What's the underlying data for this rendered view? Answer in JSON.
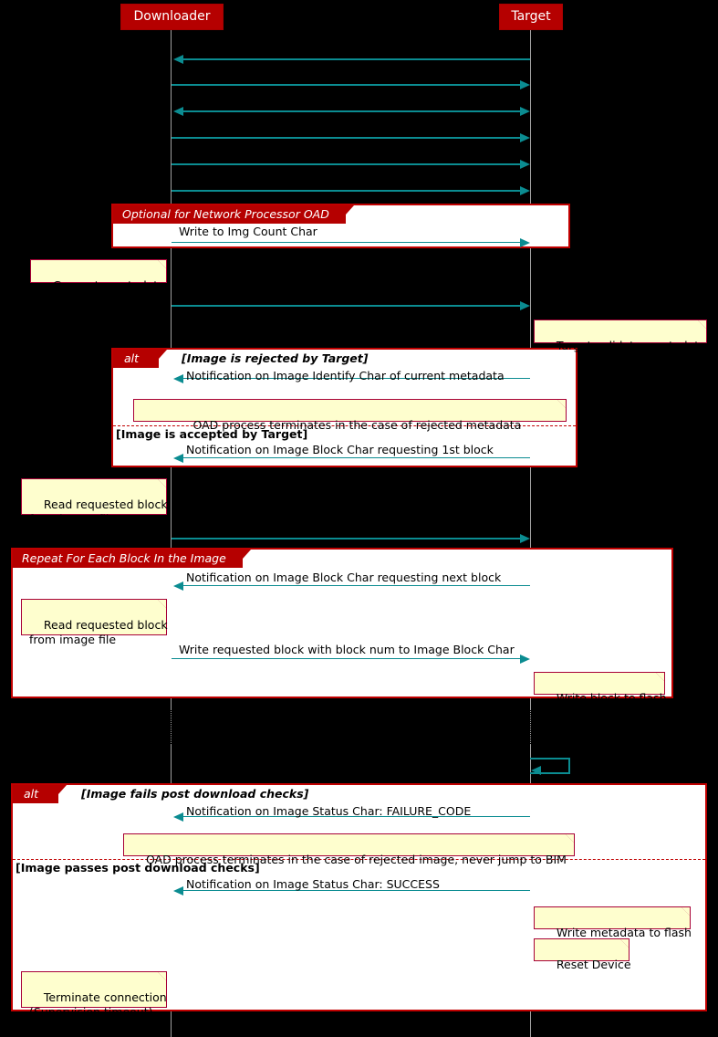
{
  "diagram": {
    "kind": "sequence-diagram",
    "title": "",
    "colors": {
      "background": "#000000",
      "participant_fill": "#B50000",
      "participant_text": "#FFFFFF",
      "arrow": "#0B8C91",
      "lifeline": "#A0A0A0",
      "group_border": "#C00000",
      "group_tab_fill": "#B50000",
      "note_fill": "#FEFECE",
      "note_border": "#A80036",
      "text": "#000000"
    }
  },
  "participants": [
    {
      "id": "downloader",
      "label": "Downloader"
    },
    {
      "id": "target",
      "label": "Target"
    }
  ],
  "messages": [
    {
      "id": "m1",
      "label": "",
      "direction": "left"
    },
    {
      "id": "m2",
      "label": "",
      "direction": "right"
    },
    {
      "id": "m3",
      "label": "",
      "direction": "both"
    },
    {
      "id": "m4",
      "label": "",
      "direction": "right"
    },
    {
      "id": "m5",
      "label": "",
      "direction": "right"
    },
    {
      "id": "m6",
      "label": "",
      "direction": "right"
    },
    {
      "id": "m7",
      "label": "Write to Img Count Char",
      "direction": "right"
    },
    {
      "id": "m8",
      "label": "",
      "direction": "right"
    },
    {
      "id": "m9",
      "label": "Notification on Image Identify Char of current metadata",
      "direction": "left"
    },
    {
      "id": "m10",
      "label": "Notification on Image Block Char requesting 1st block",
      "direction": "left"
    },
    {
      "id": "m11",
      "label": "",
      "direction": "right"
    },
    {
      "id": "m12",
      "label": "Notification on Image Block Char requesting next block",
      "direction": "left"
    },
    {
      "id": "m13",
      "label": "Write requested block with block num to Image Block Char",
      "direction": "right"
    },
    {
      "id": "m14",
      "label": "",
      "direction": "self"
    },
    {
      "id": "m15",
      "label": "Notification on Image Status Char: FAILURE_CODE",
      "direction": "left"
    },
    {
      "id": "m16",
      "label": "Notification on Image Status Char: SUCCESS",
      "direction": "left"
    }
  ],
  "groups": [
    {
      "id": "g-optional",
      "tab": "Optional for Network Processor OAD",
      "conditions": []
    },
    {
      "id": "g-alt-metadata",
      "tab": "alt",
      "conditions": [
        "[Image is rejected by Target]",
        "[Image is accepted by Target]"
      ]
    },
    {
      "id": "g-repeat",
      "tab": "Repeat For Each Block In the Image",
      "conditions": []
    },
    {
      "id": "g-alt-postcheck",
      "tab": "alt",
      "conditions": [
        "[Image fails post download checks]",
        "[Image passes post download checks]"
      ]
    }
  ],
  "notes": [
    {
      "id": "n1",
      "text": "Generate metadata"
    },
    {
      "id": "n2",
      "text": "Target validates metadata"
    },
    {
      "id": "n3",
      "text": "OAD process terminates in the case of rejected metadata"
    },
    {
      "id": "n4",
      "text": "Read requested block\nfrom image file"
    },
    {
      "id": "n5",
      "text": "Read requested block\nfrom image file"
    },
    {
      "id": "n6",
      "text": "Write block to flash"
    },
    {
      "id": "n7",
      "text": "OAD process terminates in the case of rejected image, never jump to BIM"
    },
    {
      "id": "n8",
      "text": "Write metadata to flash"
    },
    {
      "id": "n9",
      "text": "Reset Device"
    },
    {
      "id": "n10",
      "text": "Terminate connection\n(Supervision timeout)"
    }
  ]
}
